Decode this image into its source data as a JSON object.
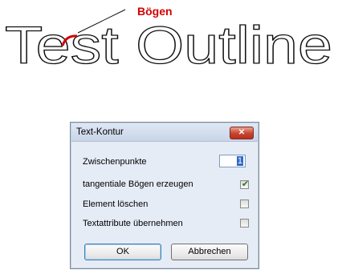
{
  "illustration": {
    "outline_text": "Test Outline",
    "annotation_label": "Bögen",
    "annotation_color": "#d40000"
  },
  "dialog": {
    "title": "Text-Kontur",
    "close_glyph": "✕",
    "fields": {
      "zwischenpunkte_label": "Zwischenpunkte",
      "zwischenpunkte_value": "1"
    },
    "options": [
      {
        "label": "tangentiale Bögen erzeugen",
        "checked": true
      },
      {
        "label": "Element löschen",
        "checked": false
      },
      {
        "label": "Textattribute übernehmen",
        "checked": false
      }
    ],
    "buttons": {
      "ok_label": "OK",
      "cancel_label": "Abbrechen"
    },
    "check_glyph": "✔"
  }
}
